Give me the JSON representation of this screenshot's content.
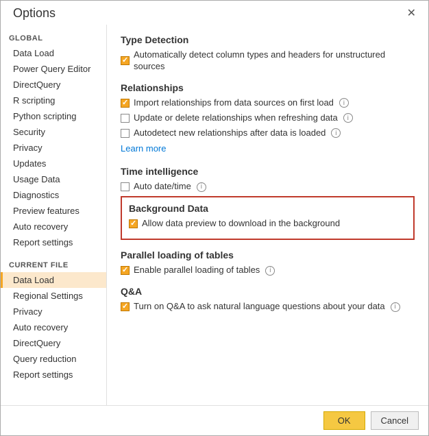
{
  "dialog": {
    "title": "Options",
    "close_label": "✕"
  },
  "sidebar": {
    "global_label": "GLOBAL",
    "global_items": [
      {
        "id": "data-load",
        "label": "Data Load",
        "active": false
      },
      {
        "id": "power-query-editor",
        "label": "Power Query Editor",
        "active": false
      },
      {
        "id": "directquery",
        "label": "DirectQuery",
        "active": false
      },
      {
        "id": "r-scripting",
        "label": "R scripting",
        "active": false
      },
      {
        "id": "python-scripting",
        "label": "Python scripting",
        "active": false
      },
      {
        "id": "security",
        "label": "Security",
        "active": false
      },
      {
        "id": "privacy",
        "label": "Privacy",
        "active": false
      },
      {
        "id": "updates",
        "label": "Updates",
        "active": false
      },
      {
        "id": "usage-data",
        "label": "Usage Data",
        "active": false
      },
      {
        "id": "diagnostics",
        "label": "Diagnostics",
        "active": false
      },
      {
        "id": "preview-features",
        "label": "Preview features",
        "active": false
      },
      {
        "id": "auto-recovery",
        "label": "Auto recovery",
        "active": false
      },
      {
        "id": "report-settings",
        "label": "Report settings",
        "active": false
      }
    ],
    "current_file_label": "CURRENT FILE",
    "current_file_items": [
      {
        "id": "cf-data-load",
        "label": "Data Load",
        "active": true
      },
      {
        "id": "cf-regional-settings",
        "label": "Regional Settings",
        "active": false
      },
      {
        "id": "cf-privacy",
        "label": "Privacy",
        "active": false
      },
      {
        "id": "cf-auto-recovery",
        "label": "Auto recovery",
        "active": false
      },
      {
        "id": "cf-directquery",
        "label": "DirectQuery",
        "active": false
      },
      {
        "id": "cf-query-reduction",
        "label": "Query reduction",
        "active": false
      },
      {
        "id": "cf-report-settings",
        "label": "Report settings",
        "active": false
      }
    ]
  },
  "main": {
    "type_detection": {
      "title": "Type Detection",
      "checkbox1_label": "Automatically detect column types and headers for unstructured sources",
      "checkbox1_checked": true
    },
    "relationships": {
      "title": "Relationships",
      "checkbox1_label": "Import relationships from data sources on first load",
      "checkbox1_checked": true,
      "checkbox2_label": "Update or delete relationships when refreshing data",
      "checkbox2_checked": false,
      "checkbox3_label": "Autodetect new relationships after data is loaded",
      "checkbox3_checked": false,
      "learn_more": "Learn more"
    },
    "time_intelligence": {
      "title": "Time intelligence",
      "checkbox1_label": "Auto date/time",
      "checkbox1_checked": false
    },
    "background_data": {
      "title": "Background Data",
      "checkbox1_label": "Allow data preview to download in the background",
      "checkbox1_checked": true
    },
    "parallel_loading": {
      "title": "Parallel loading of tables",
      "checkbox1_label": "Enable parallel loading of tables",
      "checkbox1_checked": true
    },
    "qa": {
      "title": "Q&A",
      "checkbox1_label": "Turn on Q&A to ask natural language questions about your data",
      "checkbox1_checked": true
    }
  },
  "footer": {
    "ok_label": "OK",
    "cancel_label": "Cancel"
  }
}
